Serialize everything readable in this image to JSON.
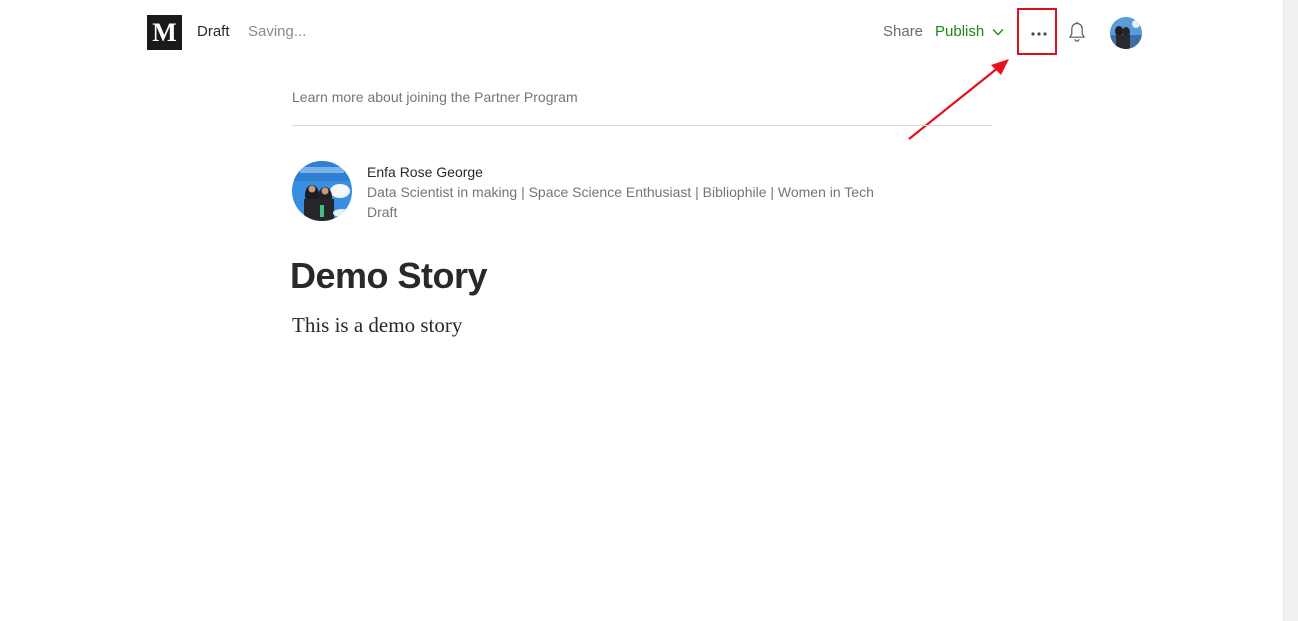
{
  "header": {
    "logo_letter": "M",
    "draft_label": "Draft",
    "saving_label": "Saving...",
    "share_label": "Share",
    "publish_label": "Publish",
    "more_icon": "more-dots-icon",
    "bell_icon": "bell-icon"
  },
  "partner": {
    "link_text": "Learn more about joining the Partner Program"
  },
  "author": {
    "name": "Enfa Rose George",
    "bio": "Data Scientist in making | Space Science Enthusiast | Bibliophile | Women in Tech",
    "status": "Draft"
  },
  "story": {
    "title": "Demo Story",
    "body": "This is a demo story"
  },
  "colors": {
    "publish_green": "#1a8917",
    "highlight_red": "#e0101a",
    "text_dark": "#292929",
    "text_muted": "#757575"
  }
}
